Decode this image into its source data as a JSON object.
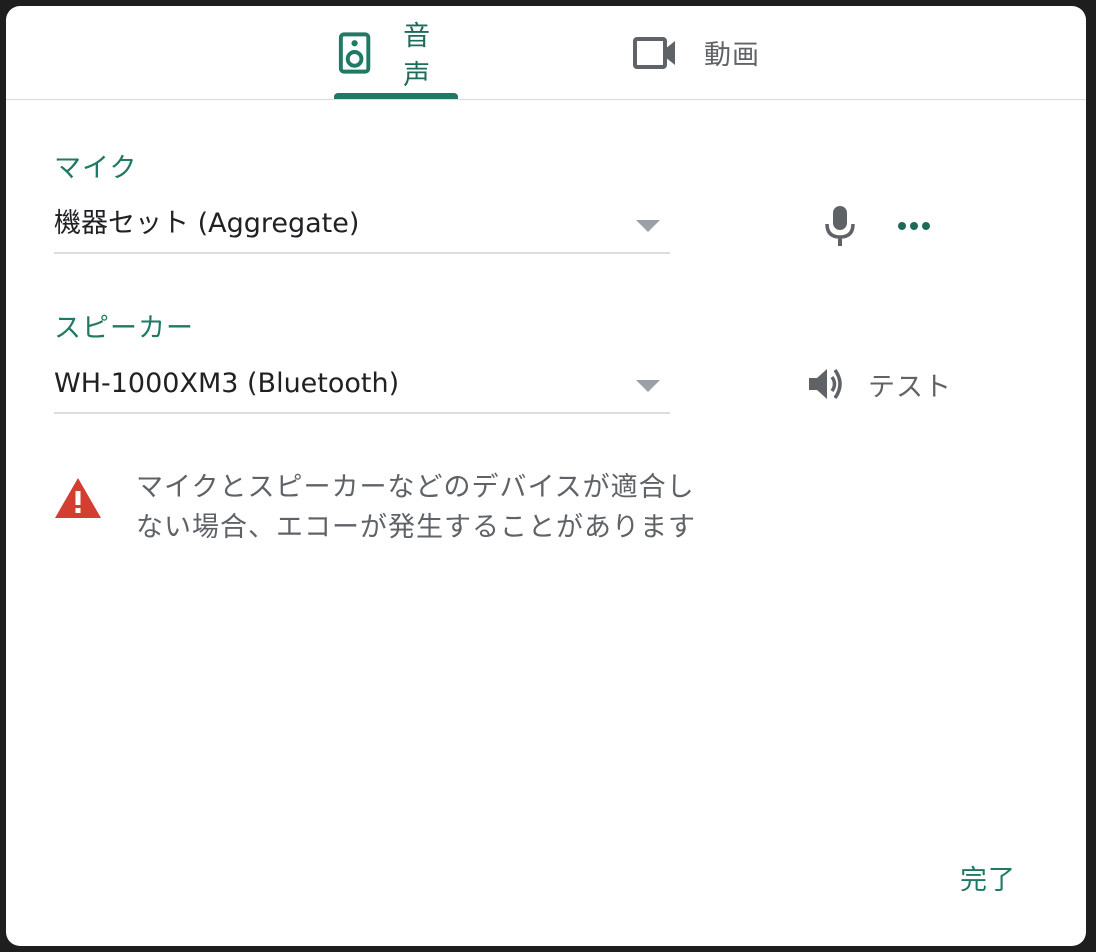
{
  "tabs": {
    "audio_label": "音声",
    "video_label": "動画"
  },
  "microphone": {
    "label": "マイク",
    "selected": "機器セット (Aggregate)"
  },
  "speaker": {
    "label": "スピーカー",
    "selected": "WH-1000XM3 (Bluetooth)",
    "test_label": "テスト"
  },
  "warning": {
    "text": "マイクとスピーカーなどのデバイスが適合しない場合、エコーが発生することがあります"
  },
  "footer": {
    "done_label": "完了"
  },
  "colors": {
    "accent": "#1e7a64",
    "warning": "#d23f31",
    "icon_gray": "#5f6368"
  },
  "icons": {
    "audio_tab": "speaker-device-icon",
    "video_tab": "videocam-icon",
    "mic": "mic-icon",
    "more": "more-horiz-icon",
    "volume": "volume-up-icon",
    "warning": "warning-triangle-icon"
  }
}
